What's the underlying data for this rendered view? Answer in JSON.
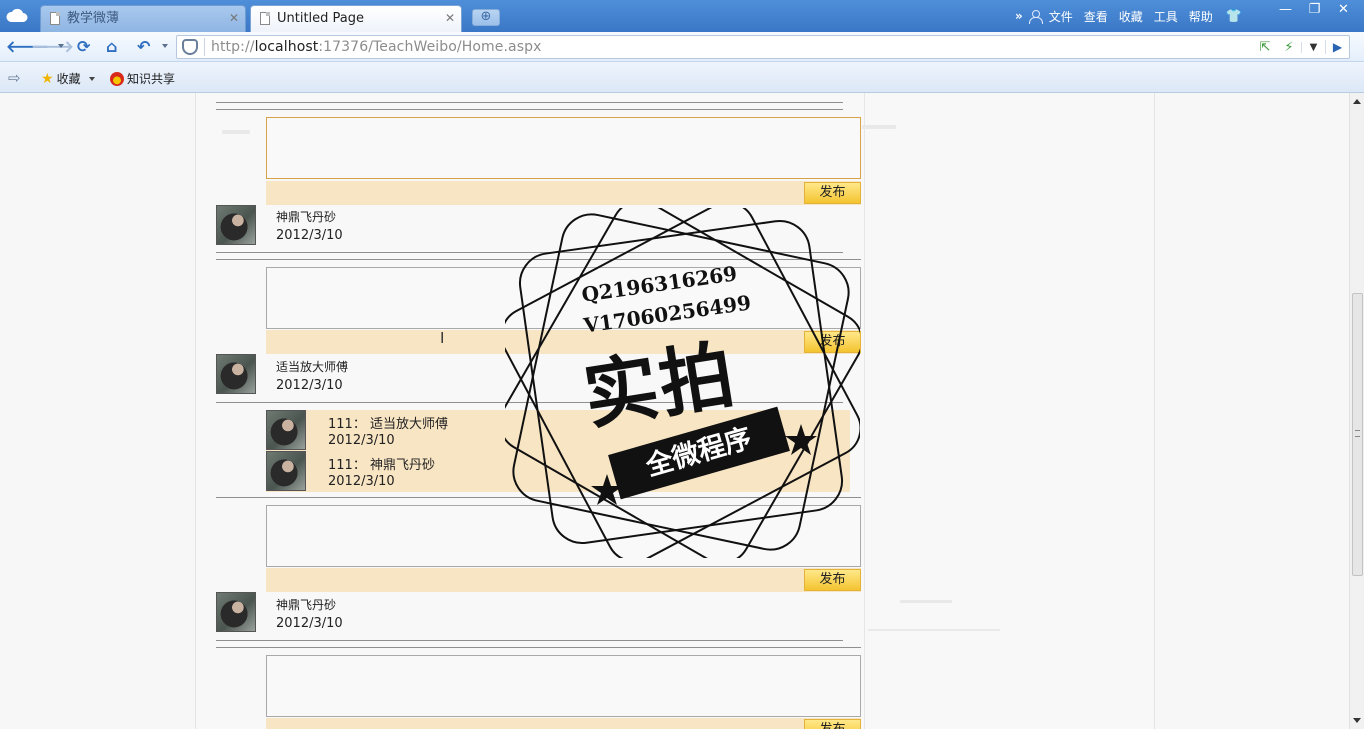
{
  "browser": {
    "tabs": [
      {
        "label": "教学微薄",
        "active": false
      },
      {
        "label": "Untitled Page",
        "active": true
      }
    ],
    "tab_close": "✕",
    "new_tab": "⊕",
    "menu_more": "»",
    "menus": [
      "文件",
      "查看",
      "收藏",
      "工具",
      "帮助"
    ],
    "window_controls": [
      "—",
      "❐",
      "✕"
    ],
    "url_prefix": "http://",
    "url_host": "localhost",
    "url_rest": ":17376/TeachWeibo/Home.aspx",
    "favorites": {
      "collect_label": "收藏",
      "share_label": "知识共享"
    }
  },
  "feed": {
    "publish_label": "发布",
    "posts": [
      {
        "author": "神鼎飞丹砂",
        "date": "2012/3/10"
      },
      {
        "author": "适当放大师傅",
        "date": "2012/3/10"
      },
      {
        "author": "神鼎飞丹砂",
        "date": "2012/3/10"
      }
    ],
    "replies": [
      {
        "text": "111：  适当放大师傅",
        "date": "2012/3/10"
      },
      {
        "text": "111：  神鼎飞丹砂",
        "date": "2012/3/10"
      }
    ],
    "partial_publish_label": "发布"
  },
  "stamp": {
    "line1": "Q2196316269",
    "line2": "V17060256499",
    "big": "实拍",
    "banner": "全微程序"
  }
}
